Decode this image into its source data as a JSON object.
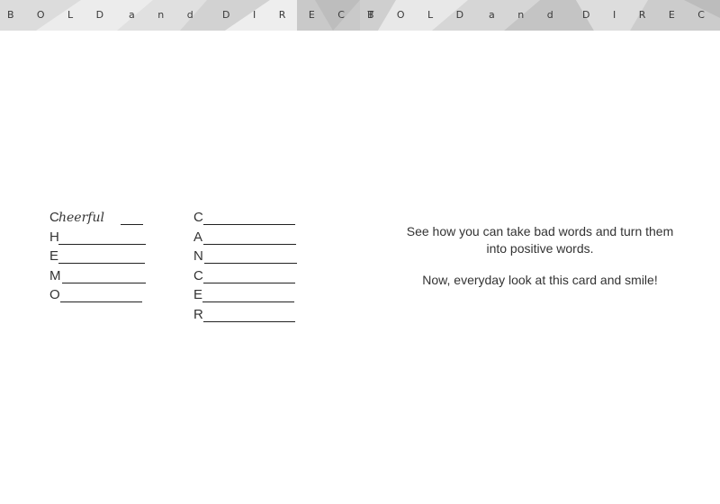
{
  "banner": {
    "left": {
      "word1": "BOLD",
      "word2": "and",
      "word3": "DIRECT"
    },
    "right": {
      "word1": "BOLD",
      "word2": "and",
      "word3": "DIRECT"
    }
  },
  "acrostic_chemo": [
    {
      "letter": "C",
      "answer": "heerful"
    },
    {
      "letter": "H",
      "answer": ""
    },
    {
      "letter": "E",
      "answer": ""
    },
    {
      "letter": "M",
      "answer": ""
    },
    {
      "letter": "O",
      "answer": ""
    }
  ],
  "acrostic_cancer": [
    {
      "letter": "C"
    },
    {
      "letter": "A"
    },
    {
      "letter": "N"
    },
    {
      "letter": "C"
    },
    {
      "letter": "E"
    },
    {
      "letter": "R"
    }
  ],
  "message": {
    "line1": "See how you can take bad words and turn them into positive words.",
    "line2": "Now, everyday look at this card and smile!"
  }
}
